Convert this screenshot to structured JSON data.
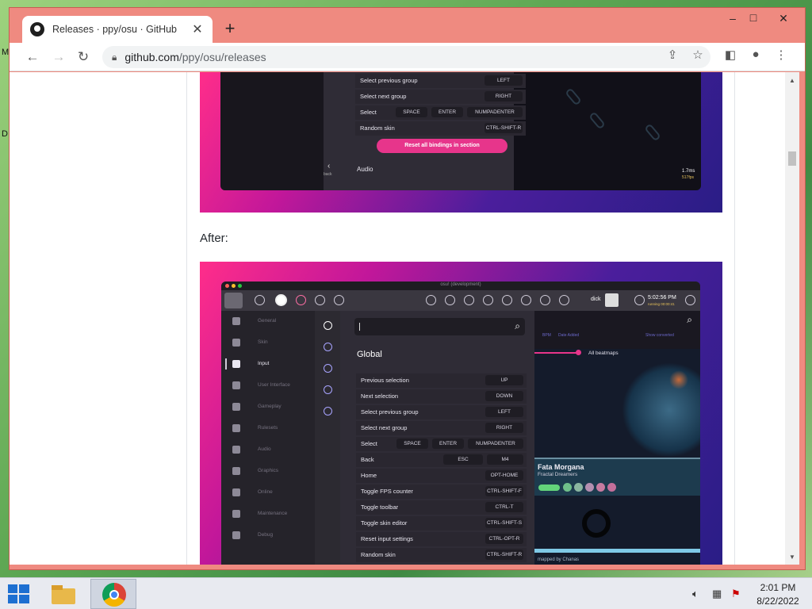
{
  "desktop": {
    "left_letters": [
      "M",
      "D"
    ]
  },
  "browser": {
    "tab_title": "Releases · ppy/osu · GitHub",
    "tab_close": "✕",
    "new_tab": "+",
    "window_controls": [
      "–",
      "□",
      "✕"
    ],
    "url_host": "github.com",
    "url_path": "/ppy/osu/releases"
  },
  "page": {
    "after_label": "After:"
  },
  "shot_before": {
    "rows": [
      {
        "label": "Select previous group",
        "keys": [
          "LEFT"
        ]
      },
      {
        "label": "Select next group",
        "keys": [
          "RIGHT"
        ]
      },
      {
        "label": "Select",
        "keys": [
          "SPACE",
          "ENTER",
          "NUMPADENTER"
        ]
      },
      {
        "label": "Random skin",
        "keys": [
          "CTRL-SHIFT-R"
        ]
      }
    ],
    "reset_button": "Reset all bindings in section",
    "back_label": "back",
    "audio_label": "Audio",
    "fps_ms": "1.7ms",
    "fps_fps": "517fps"
  },
  "shot_after": {
    "app_title": "osu! (development)",
    "user": "dick",
    "clock": "5:02:56 PM",
    "clock_sub": "running 00:00:41",
    "sidebar": [
      "General",
      "Skin",
      "Input",
      "User Interface",
      "Gameplay",
      "Rulesets",
      "Audio",
      "Graphics",
      "Online",
      "Maintenance",
      "Debug"
    ],
    "section_title": "Global",
    "rows": [
      {
        "label": "Previous selection",
        "keys": [
          "UP"
        ]
      },
      {
        "label": "Next selection",
        "keys": [
          "DOWN"
        ]
      },
      {
        "label": "Select previous group",
        "keys": [
          "LEFT"
        ]
      },
      {
        "label": "Select next group",
        "keys": [
          "RIGHT"
        ]
      },
      {
        "label": "Select",
        "keys": [
          "SPACE",
          "ENTER",
          "NUMPADENTER"
        ]
      },
      {
        "label": "Back",
        "keys": [
          "ESC",
          "M4"
        ]
      },
      {
        "label": "Home",
        "keys": [
          "OPT-HOME"
        ]
      },
      {
        "label": "Toggle FPS counter",
        "keys": [
          "CTRL-SHIFT-F"
        ]
      },
      {
        "label": "Toggle toolbar",
        "keys": [
          "CTRL-T"
        ]
      },
      {
        "label": "Toggle skin editor",
        "keys": [
          "CTRL-SHIFT-S"
        ]
      },
      {
        "label": "Reset input settings",
        "keys": [
          "CTRL-OPT-R"
        ]
      },
      {
        "label": "Random skin",
        "keys": [
          "CTRL-SHIFT-R"
        ]
      }
    ],
    "filter_row": [
      "BPM",
      "Date Added"
    ],
    "show_converted": "Show converted",
    "all_beatmaps": "All beatmaps",
    "song_title": "Fata Morgana",
    "song_artist": "Fractal Dreamers",
    "mapped_by": "mapped by Chanas"
  },
  "taskbar": {
    "time": "2:01 PM",
    "date": "8/22/2022"
  }
}
